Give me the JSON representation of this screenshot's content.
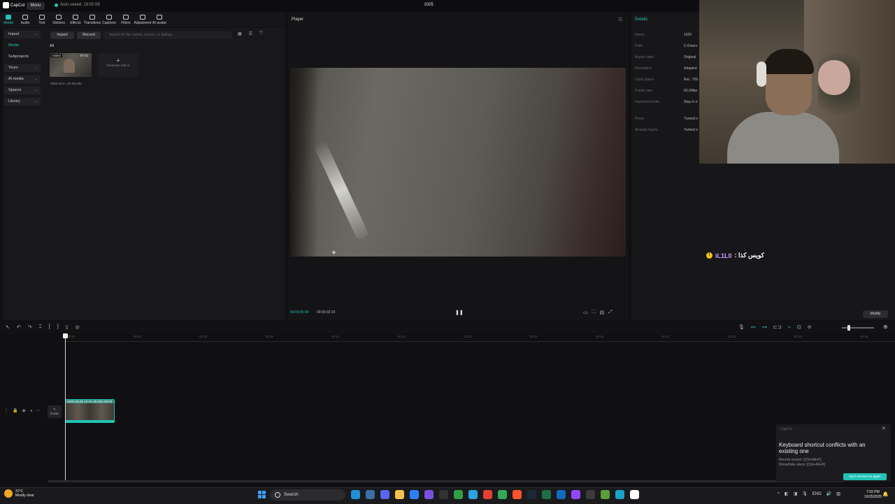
{
  "app": {
    "logo_text": "CapCut",
    "menu_label": "Menu",
    "autosave": "Auto saved: 19:02:08",
    "project_title": "1025"
  },
  "toolbar": {
    "tools": [
      {
        "label": "Media",
        "icon": "media-icon",
        "active": true
      },
      {
        "label": "Audio",
        "icon": "audio-icon"
      },
      {
        "label": "Text",
        "icon": "text-icon"
      },
      {
        "label": "Stickers",
        "icon": "stickers-icon"
      },
      {
        "label": "Effects",
        "icon": "effects-icon"
      },
      {
        "label": "Transitions",
        "icon": "transitions-icon"
      },
      {
        "label": "Captions",
        "icon": "captions-icon"
      },
      {
        "label": "Filters",
        "icon": "filters-icon"
      },
      {
        "label": "Adjustment",
        "icon": "adjustment-icon"
      },
      {
        "label": "AI avatar",
        "icon": "ai-avatar-icon"
      }
    ]
  },
  "sidebar": {
    "items": [
      {
        "label": "Import",
        "boxed": true,
        "chevron": true
      },
      {
        "label": "Media",
        "active": true
      },
      {
        "label": "Subprojects"
      },
      {
        "label": "Yours",
        "boxed": true,
        "chevron": true
      },
      {
        "label": "AI media",
        "boxed": true,
        "chevron": true
      },
      {
        "label": "Spaces",
        "boxed": true,
        "chevron": true
      },
      {
        "label": "Library",
        "boxed": true,
        "chevron": true
      }
    ]
  },
  "media_panel": {
    "import_label": "Import",
    "record_label": "Record",
    "search_placeholder": "Search for file names, scenes, or dialogs",
    "tab_all": "All",
    "item": {
      "badge": "Added",
      "duration": "07:41",
      "name": "2025-10-2...02-38.mkv"
    },
    "generate_label": "Generate with AI"
  },
  "player": {
    "title": "Player",
    "time_current": "00:00:00:04",
    "time_total": "00:00:02:19"
  },
  "details": {
    "title": "Details",
    "rows": [
      {
        "label": "Name:",
        "value": "1025"
      },
      {
        "label": "Path:",
        "value": "C:/Users"
      },
      {
        "label": "Aspect ratio:",
        "value": "Original"
      },
      {
        "label": "Resolution:",
        "value": "Adapted"
      },
      {
        "label": "Color space:",
        "value": "Rec. 709"
      },
      {
        "label": "Frame rate:",
        "value": "60.00fps"
      },
      {
        "label": "Imported media:",
        "value": "Stay in o"
      },
      {
        "label": "Proxy:",
        "value": "Turned o"
      },
      {
        "label": "Arrange layers",
        "value": "Turned o"
      }
    ],
    "modify_label": "Modify"
  },
  "stream_overlay": {
    "chat_user": "iL1L0",
    "chat_text": ": كويس كذا"
  },
  "timeline": {
    "ticks": [
      "00:00",
      "00:03",
      "00:06",
      "00:09",
      "00:12",
      "00:15",
      "00:18",
      "00:21",
      "00:24",
      "00:27",
      "00:30",
      "00:33",
      "00:36"
    ],
    "cover_label": "Cover",
    "clip_label": "2025-10-25 19-02-38.mkv  00:00"
  },
  "toast": {
    "app": "CapCut",
    "title": "Keyboard shortcut conflicts with an existing one",
    "line1": "Record screen: [Ctrl+Alt+F]",
    "line2": "Show/hide rulers: [Ctrl+Alt+R]",
    "button": "Don't remind me again"
  },
  "taskbar": {
    "temperature": "31°C",
    "weather": "Mostly clear",
    "search_label": "Search",
    "apps": [
      {
        "name": "edge-icon",
        "color": "#1f8fd6"
      },
      {
        "name": "taskview-icon",
        "color": "#3a6ea5"
      },
      {
        "name": "discord-icon",
        "color": "#5865f2"
      },
      {
        "name": "explorer-icon",
        "color": "#f2c14e"
      },
      {
        "name": "notes-icon",
        "color": "#2d7ff9"
      },
      {
        "name": "app-purple-icon",
        "color": "#7b4fe0"
      },
      {
        "name": "app-dark-icon",
        "color": "#333333"
      },
      {
        "name": "xbox-icon",
        "color": "#2ea043"
      },
      {
        "name": "telegram-icon",
        "color": "#2aa3e0"
      },
      {
        "name": "chrome-icon",
        "color": "#e34133"
      },
      {
        "name": "chrome-alt-icon",
        "color": "#34a853"
      },
      {
        "name": "brave-icon",
        "color": "#fb542b"
      },
      {
        "name": "steam-icon",
        "color": "#1b2838"
      },
      {
        "name": "excel-icon",
        "color": "#1d6f42"
      },
      {
        "name": "app-blue-icon",
        "color": "#0f6cbd"
      },
      {
        "name": "twitch-icon",
        "color": "#9146ff"
      },
      {
        "name": "obs-icon",
        "color": "#3b3b3b"
      },
      {
        "name": "minecraft-icon",
        "color": "#5a9e3a"
      },
      {
        "name": "app-cyan-icon",
        "color": "#1aa3c8"
      },
      {
        "name": "capcut-icon",
        "color": "#ffffff"
      }
    ],
    "lang": "ENG",
    "time": "7:02 PM",
    "date": "10/25/2025"
  },
  "colors": {
    "accent": "#21c3b5"
  }
}
